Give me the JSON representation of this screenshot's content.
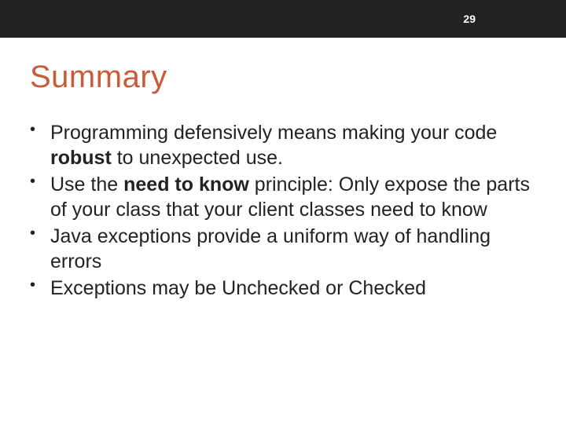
{
  "page_number": "29",
  "title": "Summary",
  "bullets": [
    {
      "pre": "Programming defensively means making your code ",
      "bold": "robust",
      "post": " to unexpected use."
    },
    {
      "pre": "Use the ",
      "bold": "need to know",
      "post": " principle: Only expose the parts of your class that your client classes need to know"
    },
    {
      "pre": "Java exceptions provide a uniform way of handling errors",
      "bold": "",
      "post": ""
    },
    {
      "pre": "Exceptions may be Unchecked or Checked",
      "bold": "",
      "post": ""
    }
  ]
}
